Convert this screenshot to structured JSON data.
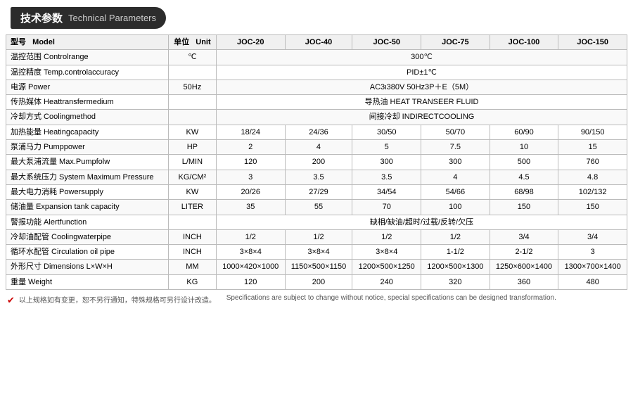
{
  "header": {
    "zh_label": "技术参数",
    "en_label": "Technical Parameters"
  },
  "table": {
    "columns": {
      "param_zh": "型号",
      "param_en": "Model",
      "unit_zh": "单位",
      "unit_en": "Unit",
      "models": [
        "JOC-20",
        "JOC-40",
        "JOC-50",
        "JOC-75",
        "JOC-100",
        "JOC-150"
      ]
    },
    "rows": [
      {
        "param": "温控范围 Controlrange",
        "unit": "℃",
        "values": [
          "300℃",
          null,
          null,
          null,
          null,
          null
        ],
        "span": 6
      },
      {
        "param": "温控精度 Temp.controlaccuracy",
        "unit": "",
        "values": [
          "PID±1℃",
          null,
          null,
          null,
          null,
          null
        ],
        "span": 6
      },
      {
        "param": "电源 Power",
        "unit": "50Hz",
        "values": [
          "AC3ι380V 50Hz3P＋E（5M）",
          null,
          null,
          null,
          null,
          null
        ],
        "span": 6
      },
      {
        "param": "传热媒体 Heattransfermedium",
        "unit": "",
        "values": [
          "导热油 HEAT TRANSEER FLUID",
          null,
          null,
          null,
          null,
          null
        ],
        "span": 6
      },
      {
        "param": "冷却方式 Coolingmethod",
        "unit": "",
        "values": [
          "间接冷却 INDIRECTCOOLING",
          null,
          null,
          null,
          null,
          null
        ],
        "span": 6
      },
      {
        "param": "加热能量 Heatingcapacity",
        "unit": "KW",
        "values": [
          "18/24",
          "24/36",
          "30/50",
          "50/70",
          "60/90",
          "90/150"
        ],
        "span": 0
      },
      {
        "param": "泵浦马力 Pumppower",
        "unit": "HP",
        "values": [
          "2",
          "4",
          "5",
          "7.5",
          "10",
          "15"
        ],
        "span": 0
      },
      {
        "param": "最大泵浦流量 Max.Pumpfolw",
        "unit": "L/MIN",
        "values": [
          "120",
          "200",
          "300",
          "300",
          "500",
          "760"
        ],
        "span": 0
      },
      {
        "param": "最大系统压力 System Maximum Pressure",
        "unit": "KG/CM²",
        "values": [
          "3",
          "3.5",
          "3.5",
          "4",
          "4.5",
          "4.8"
        ],
        "span": 0
      },
      {
        "param": "最大电力消耗 Powersupply",
        "unit": "KW",
        "values": [
          "20/26",
          "27/29",
          "34/54",
          "54/66",
          "68/98",
          "102/132"
        ],
        "span": 0
      },
      {
        "param": "储油量 Expansion tank capacity",
        "unit": "LITER",
        "values": [
          "35",
          "55",
          "70",
          "100",
          "150",
          "150"
        ],
        "span": 0
      },
      {
        "param": "警报功能 Alertfunction",
        "unit": "",
        "values": [
          "缺相/缺油/超时/过载/反转/欠压",
          null,
          null,
          null,
          null,
          null
        ],
        "span": 6
      },
      {
        "param": "冷却油配管 Coolingwaterpipe",
        "unit": "INCH",
        "values": [
          "1/2",
          "1/2",
          "1/2",
          "1/2",
          "3/4",
          "3/4"
        ],
        "span": 0
      },
      {
        "param": "循环水配管 Circulation oil pipe",
        "unit": "INCH",
        "values": [
          "3×8×4",
          "3×8×4",
          "3×8×4",
          "1-1/2",
          "2-1/2",
          "3"
        ],
        "span": 0
      },
      {
        "param": "外形尺寸 Dimensions L×W×H",
        "unit": "MM",
        "values": [
          "1000×420×1000",
          "1150×500×1150",
          "1200×500×1250",
          "1200×500×1300",
          "1250×600×1400",
          "1300×700×1400"
        ],
        "span": 0
      },
      {
        "param": "重量 Weight",
        "unit": "KG",
        "values": [
          "120",
          "200",
          "240",
          "320",
          "360",
          "480"
        ],
        "span": 0
      }
    ]
  },
  "footer": {
    "check_icon": "✔",
    "zh_text": "以上规格如有变更，恕不另行通知，特殊规格可另行设计改造。",
    "en_text": "Specifications are subject to change without notice, special specifications can be designed transformation."
  }
}
